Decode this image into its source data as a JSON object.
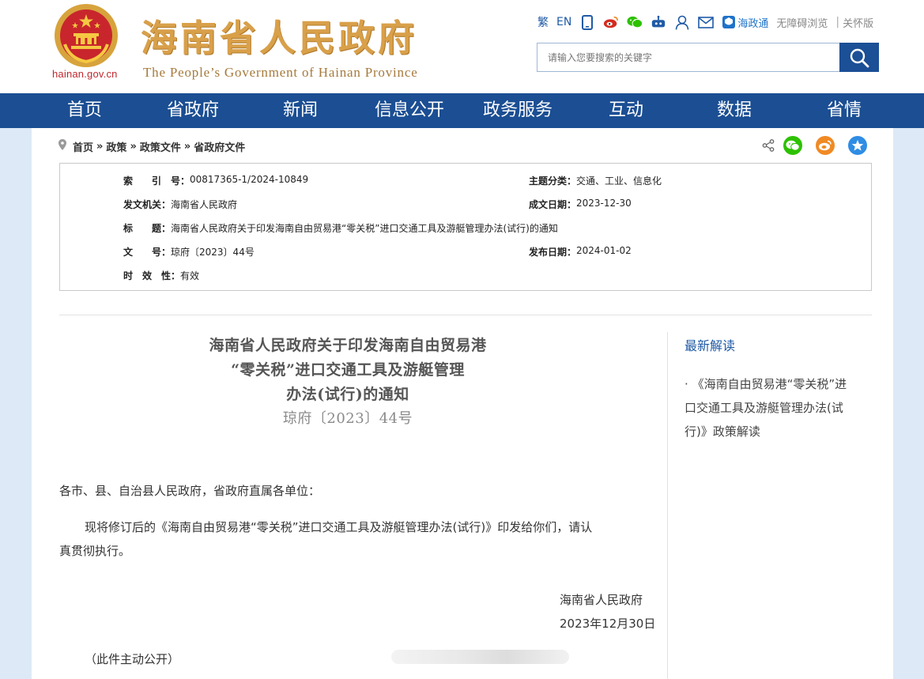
{
  "header": {
    "site_title_cn": "海南省人民政府",
    "site_title_en": "The People’s Government  of Hainan Province",
    "domain": "hainan.gov.cn",
    "top_links": {
      "traditional": "繁",
      "english": "EN",
      "haizhengtong": "海政通",
      "accessibility": "无障碍浏览",
      "separator": "|",
      "elder_mode": "关怀版"
    },
    "icons": [
      "mobile-icon",
      "weibo-icon",
      "wechat-icon",
      "robot-icon",
      "user-icon",
      "mail-icon"
    ],
    "search": {
      "placeholder": "请输入您要搜索的关键字"
    }
  },
  "nav": {
    "items": [
      "首页",
      "省政府",
      "新闻",
      "信息公开",
      "政务服务",
      "互动",
      "数据",
      "省情"
    ]
  },
  "breadcrumb": {
    "items": [
      "首页",
      "政策",
      "政策文件",
      "省政府文件"
    ],
    "separator": "»"
  },
  "meta": {
    "index_label": "索　　引　号：",
    "index_value": "00817365-1/2024-10849",
    "category_label": "主题分类：",
    "category_value": "交通、工业、信息化",
    "issuer_label": "发文机关：",
    "issuer_value": "海南省人民政府",
    "written_label": "成文日期：",
    "written_value": "2023-12-30",
    "title_label": "标　　题：",
    "title_value": "海南省人民政府关于印发海南自由贸易港“零关税”进口交通工具及游艇管理办法(试行)的通知",
    "docno_label": "文　　号：",
    "docno_value": "琼府〔2023〕44号",
    "published_label": "发布日期：",
    "published_value": "2024-01-02",
    "validity_label": "时　效　性：",
    "validity_value": "有效"
  },
  "document": {
    "title_line1": "海南省人民政府关于印发海南自由贸易港",
    "title_line2": "“零关税”进口交通工具及游艇管理",
    "title_line3": "办法(试行)的通知",
    "doc_number": "琼府〔2023〕44号",
    "salutation": "各市、县、自治县人民政府，省政府直属各单位：",
    "paragraph": "现将修订后的《海南自由贸易港“零关税”进口交通工具及游艇管理办法(试行)》印发给你们，请认真贯彻执行。",
    "paragraph_line1": "现将修订后的《海南自由贸易港“零关税”进口交通工具及游艇管理办法(试行)》印发给你们，请认",
    "paragraph_line2": "真贯彻执行。",
    "signature": "海南省人民政府",
    "date": "2023年12月30日",
    "note": "（此件主动公开）"
  },
  "sidebar": {
    "title": "最新解读",
    "bullet": "·",
    "link": "《海南自由贸易港“零关税”进口交通工具及游艇管理办法(试行)》政策解读",
    "link_line1": "《海南自由贸易港“零关税”进",
    "link_line2": "口交通工具及游艇管理办法(试",
    "link_line3": "行)》政策解读"
  },
  "colors": {
    "nav_bg": "#1b4e93",
    "title_gold": "#d9a04a",
    "link_blue": "#1f5aa6",
    "emblem_red": "#c0282d",
    "wechat_green": "#2dc100",
    "weibo_orange": "#f08a24",
    "collect_blue": "#2f8de4"
  }
}
